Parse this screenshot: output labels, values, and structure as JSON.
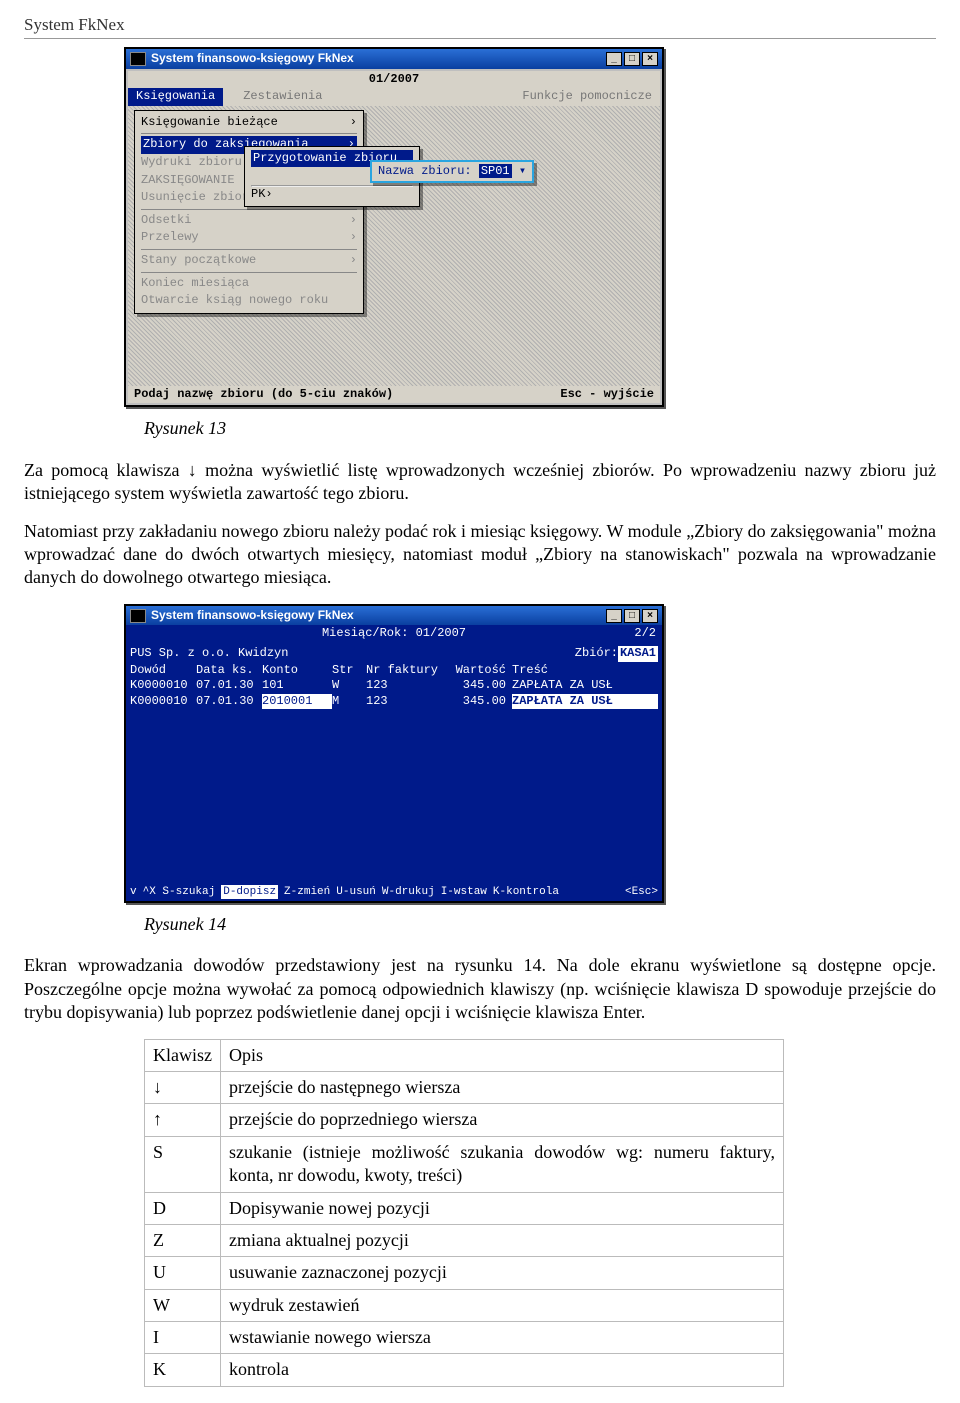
{
  "doc_header": "System FkNex",
  "screenshot1": {
    "window_title": "System finansowo-księgowy FkNex",
    "period": "01/2007",
    "menubar": {
      "active": "Księgowania",
      "mid": "Zestawienia",
      "right": "Funkcje pomocnicze"
    },
    "panel": {
      "l1": "Księgowanie bieżące",
      "l2": "Zbiory do zaksięgowania",
      "l3a": "Wydruki zbioru",
      "l3b": "ZAKSIĘGOWANIE",
      "l3c": "Usunięcie zbioru",
      "l4a": "Odsetki",
      "l4b": "Przelewy",
      "l5": "Stany początkowe",
      "l6a": "Koniec miesiąca",
      "l6b": "Otwarcie ksiąg nowego roku"
    },
    "submenu": {
      "hl": "Przygotowanie zbioru",
      "pk": "PK"
    },
    "input": {
      "label": "Nazwa zbioru:",
      "value": "SP01"
    },
    "status_left": "Podaj nazwę zbioru (do 5-ciu znaków)",
    "status_right": "Esc - wyjście"
  },
  "caption1": "Rysunek 13",
  "para1": "Za pomocą klawisza ↓ można wyświetlić listę wprowadzonych wcześniej zbiorów. Po wprowadzeniu nazwy zbioru już istniejącego system wyświetla zawartość tego zbioru.",
  "para2": "Natomiast  przy zakładaniu nowego zbioru należy podać rok i miesiąc księgowy. W module „Zbiory do zaksięgowania\" można  wprowadzać dane do dwóch otwartych miesięcy, natomiast moduł „Zbiory na stanowiskach\" pozwala na wprowadzanie danych do dowolnego otwartego miesiąca.",
  "screenshot2": {
    "window_title": "System finansowo-księgowy FkNex",
    "top_center": "Miesiąc/Rok: 01/2007",
    "top_right": "2/2",
    "company": "PUS Sp. z o.o. Kwidzyn",
    "zbior_label": "Zbiór:",
    "zbior_value": "KASA1",
    "columns": {
      "c1": "Dowód",
      "c2": "Data ks.",
      "c3": "Konto",
      "c4": "Str",
      "c5": "Nr faktury",
      "c6": "Wartość",
      "c7": "Treść"
    },
    "rows": [
      {
        "c1": "K0000010",
        "c2": "07.01.30",
        "c3": "101",
        "c4": "W",
        "c5": "123",
        "c6": "345.00",
        "c7": "ZAPŁATA ZA USŁ"
      },
      {
        "c1": "K0000010",
        "c2": "07.01.30",
        "c3": "2010001",
        "c4": "M",
        "c5": "123",
        "c6": "345.00",
        "c7": "ZAPŁATA ZA USŁ"
      }
    ],
    "footer": {
      "f0": "v",
      "f1": "^X S-szukaj",
      "f2": "D-dopisz",
      "f3": "Z-zmień",
      "f4": "U-usuń",
      "f5": "W-drukuj",
      "f6": "I-wstaw",
      "f7": "K-kontrola",
      "f8": "<Esc>"
    }
  },
  "caption2": "Rysunek 14",
  "para3": "Ekran wprowadzania dowodów przedstawiony jest na rysunku 14. Na dole ekranu wyświetlone są dostępne opcje. Poszczególne opcje można wywołać za pomocą odpowiednich klawiszy (np. wciśnięcie klawisza D spowoduje przejście do trybu dopisywania) lub poprzez podświetlenie danej opcji i wciśnięcie klawisza Enter.",
  "table": {
    "h1": "Klawisz",
    "h2": "Opis",
    "rows": [
      {
        "k": "↓",
        "d": "przejście do następnego wiersza"
      },
      {
        "k": "↑",
        "d": "przejście do poprzedniego wiersza"
      },
      {
        "k": "S",
        "d": "szukanie (istnieje możliwość szukania dowodów wg: numeru faktury, konta, nr dowodu, kwoty, treści)"
      },
      {
        "k": "D",
        "d": "Dopisywanie nowej pozycji"
      },
      {
        "k": "Z",
        "d": "zmiana aktualnej pozycji"
      },
      {
        "k": "U",
        "d": "usuwanie zaznaczonej pozycji"
      },
      {
        "k": "W",
        "d": "wydruk zestawień"
      },
      {
        "k": "I",
        "d": "wstawianie nowego wiersza"
      },
      {
        "k": "K",
        "d": "kontrola"
      }
    ]
  }
}
